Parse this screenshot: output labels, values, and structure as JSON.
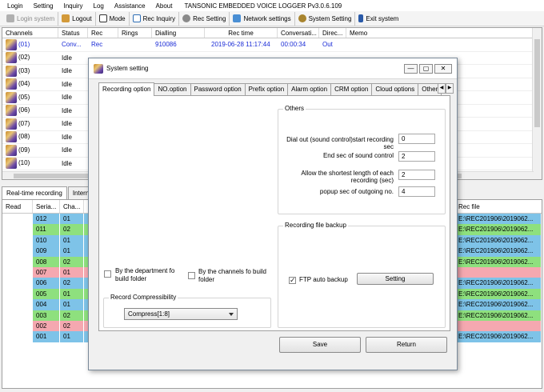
{
  "menu": {
    "items": [
      "Login",
      "Setting",
      "Inquiry",
      "Log",
      "Assistance",
      "About"
    ],
    "app_title": "TANSONIC EMBEDDED VOICE LOGGER Pv3.0.6.109"
  },
  "toolbar": {
    "items": [
      {
        "label": "Login system",
        "icon": "key-icon",
        "color": "#9a9a9a",
        "disabled": true
      },
      {
        "label": "Logout",
        "icon": "lock-icon",
        "color": "#c48a2a"
      },
      {
        "label": "Mode",
        "icon": "mode-icon",
        "color": "#2a2a2a"
      },
      {
        "label": "Rec Inquiry",
        "icon": "inquiry-icon",
        "color": "#2f6fb6"
      },
      {
        "label": "Rec Setting",
        "icon": "gear-icon",
        "color": "#777777"
      },
      {
        "label": "Network settings",
        "icon": "network-icon",
        "color": "#3b7fc4"
      },
      {
        "label": "System Setting",
        "icon": "system-icon",
        "color": "#8a6a2a"
      },
      {
        "label": "Exit system",
        "icon": "exit-icon",
        "color": "#2a5aa8"
      }
    ]
  },
  "channels": {
    "columns": [
      "Channels",
      "Status",
      "Rec",
      "Rings",
      "Dialling",
      "Rec time",
      "Conversati...",
      "Direc...",
      "Memo"
    ],
    "rows": [
      {
        "channel": "(01)",
        "status": "Conv...",
        "rec": "Rec",
        "rings": "",
        "dialling": "910086",
        "rectime": "2019-06-28 11:17:44",
        "conv": "00:00:34",
        "dir": "Out",
        "active": true
      },
      {
        "channel": "(02)",
        "status": "Idle"
      },
      {
        "channel": "(03)",
        "status": "Idle"
      },
      {
        "channel": "(04)",
        "status": "Idle"
      },
      {
        "channel": "(05)",
        "status": "Idle"
      },
      {
        "channel": "(06)",
        "status": "Idle"
      },
      {
        "channel": "(07)",
        "status": "Idle"
      },
      {
        "channel": "(08)",
        "status": "Idle"
      },
      {
        "channel": "(09)",
        "status": "Idle"
      },
      {
        "channel": "(10)",
        "status": "Idle"
      }
    ]
  },
  "bottom_tabs": [
    "Real-time recording",
    "Interne"
  ],
  "records": {
    "columns": [
      "Read",
      "Seria...",
      "Cha...",
      "Rec file"
    ],
    "rows": [
      {
        "serial": "012",
        "ch": "01",
        "file": "E:\\REC201906\\2019062...",
        "color": "#7ec3e8"
      },
      {
        "serial": "011",
        "ch": "02",
        "file": "E:\\REC201906\\2019062...",
        "color": "#8ee07e"
      },
      {
        "serial": "010",
        "ch": "01",
        "file": "E:\\REC201906\\2019062...",
        "color": "#7ec3e8"
      },
      {
        "serial": "009",
        "ch": "01",
        "file": "E:\\REC201906\\2019062...",
        "color": "#7ec3e8"
      },
      {
        "serial": "008",
        "ch": "02",
        "file": "E:\\REC201906\\2019062...",
        "color": "#8ee07e"
      },
      {
        "serial": "007",
        "ch": "01",
        "file": "",
        "color": "#f5a8b0"
      },
      {
        "serial": "006",
        "ch": "02",
        "file": "E:\\REC201906\\2019062...",
        "color": "#7ec3e8"
      },
      {
        "serial": "005",
        "ch": "01",
        "file": "E:\\REC201906\\2019062...",
        "color": "#8ee07e"
      },
      {
        "serial": "004",
        "ch": "01",
        "file": "E:\\REC201906\\2019062...",
        "color": "#7ec3e8"
      },
      {
        "serial": "003",
        "ch": "02",
        "file": "E:\\REC201906\\2019062...",
        "color": "#8ee07e"
      },
      {
        "serial": "002",
        "ch": "02",
        "file": "",
        "color": "#f5a8b0"
      },
      {
        "serial": "001",
        "ch": "01",
        "file": "E:\\REC201906\\2019062...",
        "color": "#7ec3e8"
      }
    ]
  },
  "dialog": {
    "title": "System setting",
    "tabs": [
      "Recording option",
      "NO.option",
      "Password option",
      "Prefix option",
      "Alarm option",
      "CRM option",
      "Cloud options",
      "Other"
    ],
    "selected_tab": 0,
    "others": {
      "title": "Others",
      "fields": [
        {
          "label": "Dial out (sound control)start recording sec",
          "value": "0"
        },
        {
          "label": "End sec of sound control",
          "value": "2"
        },
        {
          "label": "Allow the shortest length of each recording (sec)",
          "value": "2"
        },
        {
          "label": "popup sec of outgoing no.",
          "value": "4"
        }
      ]
    },
    "backup": {
      "title": "Recording file backup",
      "ftp_label": "FTP auto backup",
      "ftp_checked": true,
      "setting_label": "Setting"
    },
    "dept_folder_label": "By the department fo build folder",
    "channel_folder_label": "By the channels fo build folder",
    "compress": {
      "title": "Record Compressibility",
      "value": "Compress[1:8]"
    },
    "save_label": "Save",
    "return_label": "Return"
  }
}
